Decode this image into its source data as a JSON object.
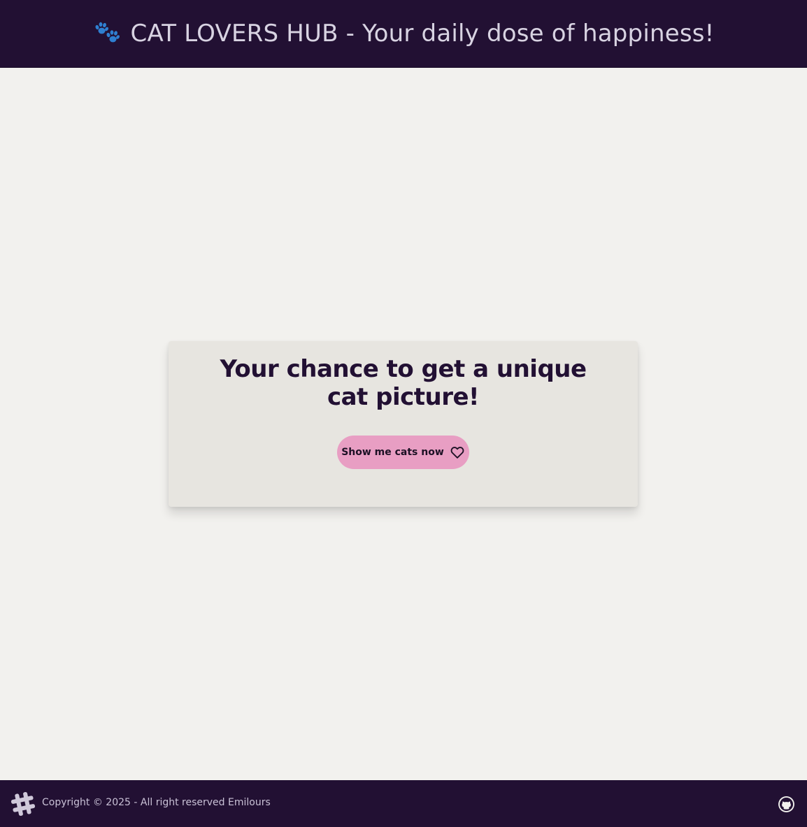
{
  "header": {
    "paw_icon": "paw-prints-icon",
    "title": "CAT LOVERS HUB - Your daily dose of happiness!"
  },
  "main": {
    "card": {
      "heading": "Your chance to get a unique cat picture!",
      "button_label": "Show me cats now",
      "button_icon": "heart-icon"
    }
  },
  "footer": {
    "logo_icon": "hashtag-icon",
    "copyright": "Copyright © 2025 - All right reserved Emilours",
    "github_icon": "github-icon"
  },
  "colors": {
    "header_bg": "#221033",
    "page_bg": "#f2f1ee",
    "card_bg": "#e7e5e0",
    "heading_text": "#221033",
    "button_bg": "#e89ec3",
    "header_text": "#d8d3e2",
    "paw_color": "#2f7fd1"
  }
}
